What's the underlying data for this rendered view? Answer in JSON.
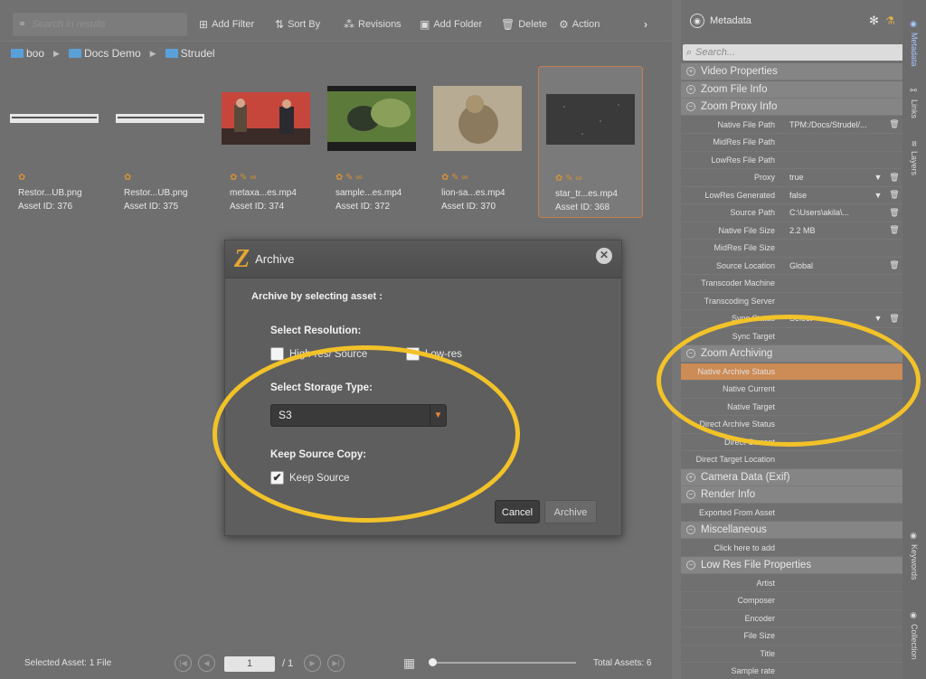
{
  "toolbar": {
    "search_placeholder": "Search in results",
    "buttons": [
      "Add Filter",
      "Sort By",
      "Revisions",
      "Add Folder",
      "Delete",
      "Action"
    ]
  },
  "breadcrumb": [
    "boo",
    "Docs Demo",
    "Strudel"
  ],
  "assets": [
    {
      "name": "Restor...UB.png",
      "id": "Asset ID: 376"
    },
    {
      "name": "Restor...UB.png",
      "id": "Asset ID: 375"
    },
    {
      "name": "metaxa...es.mp4",
      "id": "Asset ID: 374"
    },
    {
      "name": "sample...es.mp4",
      "id": "Asset ID: 372"
    },
    {
      "name": "lion-sa...es.mp4",
      "id": "Asset ID: 370"
    },
    {
      "name": "star_tr...es.mp4",
      "id": "Asset ID: 368"
    }
  ],
  "status": {
    "selected": "Selected Asset: 1 File",
    "page": "1",
    "of": "/ 1",
    "total": "Total Assets: 6"
  },
  "metadata": {
    "title": "Metadata",
    "search_placeholder": "Search...",
    "sections": {
      "video": "Video Properties",
      "zoom_file": "Zoom File Info",
      "zoom_proxy": "Zoom Proxy Info",
      "zoom_archiving": "Zoom Archiving",
      "camera": "Camera Data (Exif)",
      "render": "Render Info",
      "misc": "Miscellaneous",
      "lowres": "Low Res File Properties"
    },
    "proxy_rows": [
      {
        "label": "Native File Path",
        "value": "TPM:/Docs/Strudel/..."
      },
      {
        "label": "MidRes File Path",
        "value": ""
      },
      {
        "label": "LowRes File Path",
        "value": ""
      },
      {
        "label": "Proxy",
        "value": "true"
      },
      {
        "label": "LowRes Generated",
        "value": "false"
      },
      {
        "label": "Source Path",
        "value": "C:\\Users\\akila\\..."
      },
      {
        "label": "Native File Size",
        "value": "2.2 MB"
      },
      {
        "label": "MidRes File Size",
        "value": ""
      },
      {
        "label": "Source Location",
        "value": "Global"
      },
      {
        "label": "Transcoder Machine",
        "value": ""
      },
      {
        "label": "Transcoding Server",
        "value": ""
      },
      {
        "label": "Sync Status",
        "value": "Select"
      },
      {
        "label": "Sync Target",
        "value": ""
      }
    ],
    "archiving_rows": [
      {
        "label": "Native Archive Status",
        "value": ""
      },
      {
        "label": "Native Current",
        "value": ""
      },
      {
        "label": "Native Target",
        "value": ""
      },
      {
        "label": "Direct Archive Status",
        "value": ""
      },
      {
        "label": "Direct Current",
        "value": ""
      },
      {
        "label": "Direct Target Location",
        "value": ""
      }
    ],
    "render_rows": [
      {
        "label": "Exported From Asset",
        "value": ""
      }
    ],
    "misc_rows": [
      {
        "label": "Click here to add",
        "value": ""
      }
    ],
    "lowres_rows": [
      {
        "label": "Artist",
        "value": ""
      },
      {
        "label": "Composer",
        "value": ""
      },
      {
        "label": "Encoder",
        "value": ""
      },
      {
        "label": "File Size",
        "value": ""
      },
      {
        "label": "Title",
        "value": ""
      },
      {
        "label": "Sample rate",
        "value": ""
      }
    ]
  },
  "side_tabs": [
    "Metadata",
    "Links",
    "Layers",
    "Keywords",
    "Collection"
  ],
  "dialog": {
    "title": "Archive",
    "heading": "Archive by selecting asset :",
    "resolution_label": "Select Resolution:",
    "opt_high": "High-res/ Source",
    "opt_low": "Low-res",
    "storage_label": "Select Storage Type:",
    "storage_value": "S3",
    "keep_label": "Keep Source Copy:",
    "keep_option": "Keep Source",
    "cancel": "Cancel",
    "archive": "Archive"
  },
  "colors": {
    "accent": "#e4813b",
    "highlight_row": "#cd8b55",
    "annotation": "#f2c229"
  }
}
